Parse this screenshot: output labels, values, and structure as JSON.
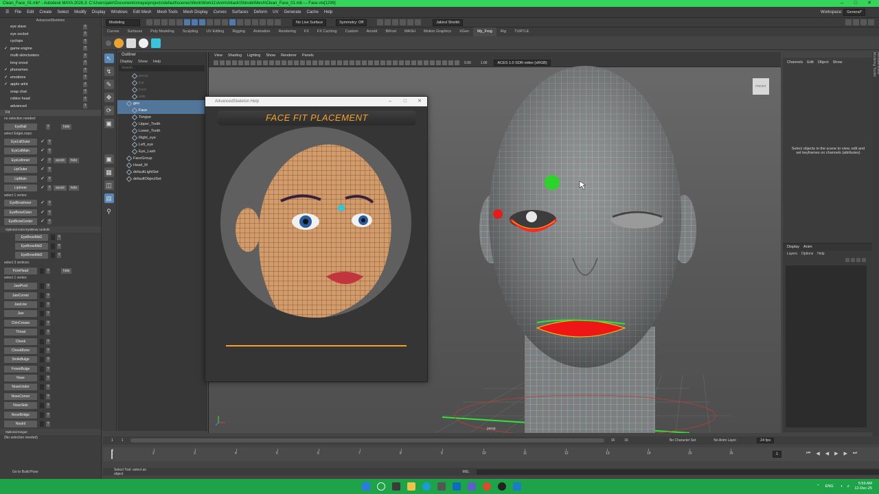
{
  "titlebar": {
    "text": "Clean_Face_01.mb* - Autodesk MAYA 2026.3: C:\\Users\\jakir\\Documents\\maya\\projects\\default\\scenes\\Work\\Work11\\Anim\\Attack\\Shinobi\\Mesh\\Clean_Face_01.mb  ---  Face.vtx[1299]"
  },
  "menubar": {
    "items": [
      "File",
      "Edit",
      "Create",
      "Select",
      "Modify",
      "Display",
      "Windows",
      "Edit Mesh",
      "Mesh Tools",
      "Mesh Display",
      "Curves",
      "Surfaces",
      "Deform",
      "UV",
      "Generate",
      "Cache",
      "Help"
    ],
    "workspace_label": "Workspace:",
    "workspace_value": "General*"
  },
  "statusline": {
    "mode": "Modeling",
    "live_surface": "No Live Surface",
    "symmetry": "Symmetry: Off",
    "user": "Jakirul Sheikh"
  },
  "shelftabs": [
    "Curves",
    "Surfaces",
    "Poly Modeling",
    "Sculpting",
    "UV Editing",
    "Rigging",
    "Animation",
    "Rendering",
    "FX",
    "FX Caching",
    "Custom",
    "Arnold",
    "Bifrost",
    "MASH",
    "Motion Graphics",
    "XGen",
    "My_Frog",
    "Rig",
    "TURTLE"
  ],
  "shelftab_active": "My_Frog",
  "leftpanel": {
    "title": "AdvancedSkeleton",
    "top_items": [
      {
        "label": "eye slave",
        "checked": false
      },
      {
        "label": "eye socket",
        "checked": false
      },
      {
        "label": "cyclops",
        "checked": false
      },
      {
        "label": "game engine",
        "checked": true
      },
      {
        "label": "multi skinclusters",
        "checked": false
      },
      {
        "label": "long snout",
        "checked": false
      },
      {
        "label": "phonemes",
        "checked": true
      },
      {
        "label": "emotions",
        "checked": true
      },
      {
        "label": "apple arkit",
        "checked": true
      },
      {
        "label": "snap chat",
        "checked": false
      },
      {
        "label": "roblox head",
        "checked": false
      },
      {
        "label": "advanced",
        "checked": false
      }
    ],
    "fit_label": "Fit",
    "no_selection": "no selection needed:",
    "eyeball": "EyeBall",
    "hide": "hide",
    "assist": "assist",
    "select_edgeloops": "select EdgeLoops:",
    "edge_items": [
      "EyeLidOuter",
      "EyeLidMain",
      "EyeLidInner",
      "LipOuter",
      "LipMain",
      "LipInner"
    ],
    "select_1_vertex": "select 1 vertex:",
    "brow_items": [
      "EyeBrowInner",
      "EyeBrowOuter",
      "EyeBrowCenter"
    ],
    "optional_brow": "Optional extra EyeBrow controls",
    "brow_mid": [
      "EyeBrowMid1",
      "EyeBrowMid2",
      "EyeBrowMid3"
    ],
    "select_3_vertices": "select 3 vertices:",
    "forehead": "ForeHead",
    "select_1_vertex_b": "select 1 vertex:",
    "lower_items": [
      "JawPivot",
      "JawCorner",
      "JawLine",
      "Jaw",
      "ChinCrease",
      "Throat",
      "Cheek",
      "CheekBone",
      "SmileBulge",
      "FrownBulge",
      "Nose",
      "NoseUnder",
      "NoseCorner",
      "NoseSide",
      "NoseBridge",
      "Nostril"
    ],
    "optional_tongue": "Optional tongue",
    "no_selection_b": "(No selection needed)",
    "build_pose": "Go to Build Pose"
  },
  "outliner": {
    "title": "Outliner",
    "menu": [
      "Display",
      "Show",
      "Help"
    ],
    "search": "Search...",
    "items": [
      {
        "label": "persp",
        "dim": true,
        "indent": 1,
        "sel": false
      },
      {
        "label": "top",
        "dim": true,
        "indent": 1,
        "sel": false
      },
      {
        "label": "front",
        "dim": true,
        "indent": 1,
        "sel": false
      },
      {
        "label": "side",
        "dim": true,
        "indent": 1,
        "sel": false
      },
      {
        "label": "geo",
        "dim": false,
        "indent": 0,
        "sel": true
      },
      {
        "label": "Face",
        "dim": false,
        "indent": 1,
        "sel": true
      },
      {
        "label": "Tongue",
        "dim": false,
        "indent": 1,
        "sel": false
      },
      {
        "label": "Upper_Tooth",
        "dim": false,
        "indent": 1,
        "sel": false
      },
      {
        "label": "Lower_Tooth",
        "dim": false,
        "indent": 1,
        "sel": false
      },
      {
        "label": "Right_eye",
        "dim": false,
        "indent": 1,
        "sel": false
      },
      {
        "label": "Left_eye",
        "dim": false,
        "indent": 1,
        "sel": false
      },
      {
        "label": "Eye_Lash",
        "dim": false,
        "indent": 1,
        "sel": false
      },
      {
        "label": "FaceGroup",
        "dim": false,
        "indent": 0,
        "sel": false
      },
      {
        "label": "Head_M",
        "dim": false,
        "indent": 0,
        "sel": false
      },
      {
        "label": "defaultLightSet",
        "dim": false,
        "indent": 0,
        "sel": false
      },
      {
        "label": "defaultObjectSet",
        "dim": false,
        "indent": 0,
        "sel": false
      }
    ]
  },
  "viewport": {
    "menu": [
      "View",
      "Shading",
      "Lighting",
      "Show",
      "Renderer",
      "Panels"
    ],
    "value_a": "0.00",
    "value_b": "1.00",
    "colorspace": "ACES 1.0 SDR-video (sRGB)",
    "camera": "persp",
    "viewcube": "FRONT"
  },
  "helpwin": {
    "title": "AdvancedSkeleton Help",
    "banner": "FACE FIT PLACEMENT"
  },
  "rightpanel": {
    "menu": [
      "Channels",
      "Edit",
      "Object",
      "Show"
    ],
    "hint": "Select objects in the scene to view, edit and set keyframes on channels (attributes)",
    "layer_tabs": [
      "Display",
      "Anim"
    ],
    "layer_menu": [
      "Layers",
      "Options",
      "Help"
    ]
  },
  "sidestrip": [
    "Channel Box / Layer Editor",
    "Attribute Editor",
    "Modeling Toolkit"
  ],
  "timeline": {
    "ticks": [
      "1",
      "2",
      "3",
      "4",
      "5",
      "6",
      "7",
      "8",
      "9",
      "10",
      "11",
      "12",
      "13",
      "14",
      "15",
      "16"
    ],
    "current": "1",
    "start": "1",
    "range_start": "1",
    "range_end": "16",
    "end": "16",
    "character_set": "No Character Set",
    "anim_layer": "No Anim Layer",
    "fps": "24 fps"
  },
  "cmdline": {
    "help": "Select Tool: select an object",
    "mel": "MEL"
  },
  "taskbar": {
    "lang": "ENG",
    "time": "5:59 AM",
    "date": "12-Dec-25"
  },
  "colors": {
    "title_green": "#37d45c",
    "accent_orange": "#f4a22a",
    "taskbar_green": "#1fa348"
  }
}
